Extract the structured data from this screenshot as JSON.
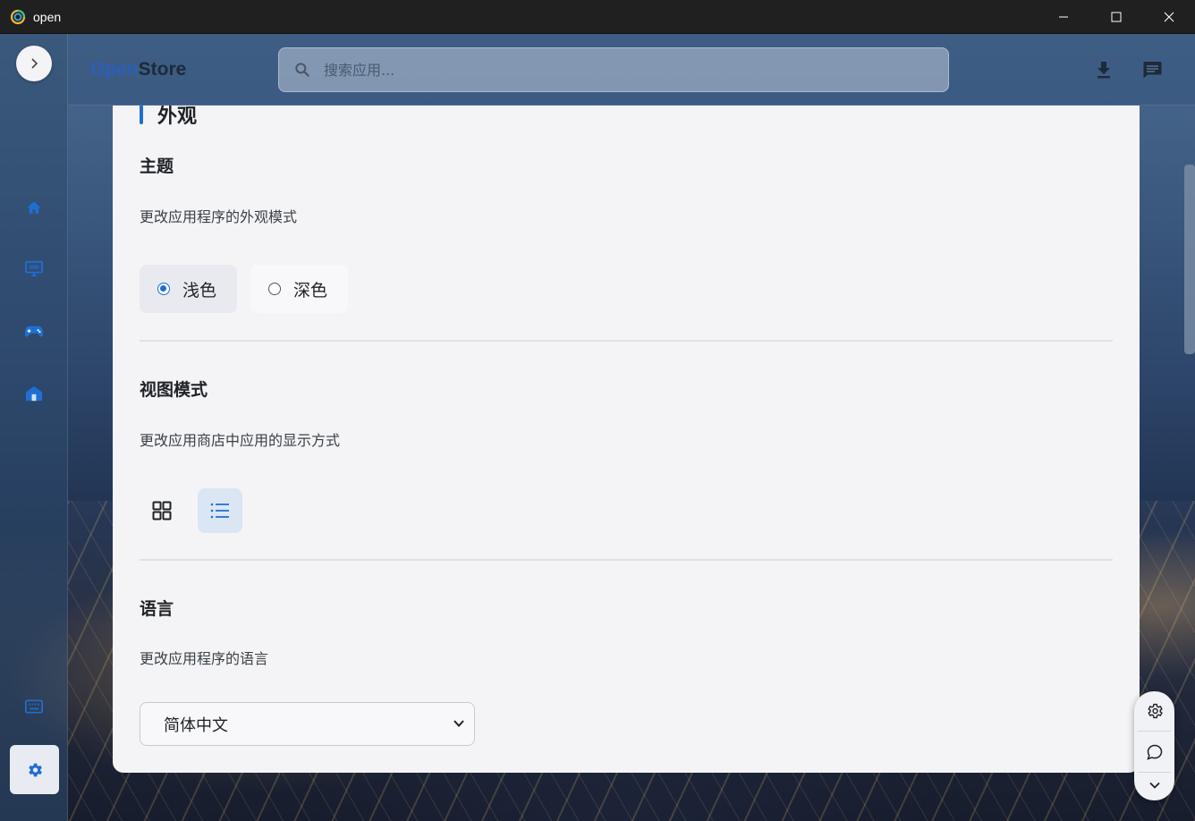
{
  "window": {
    "title": "open"
  },
  "header": {
    "brand_part1": "Open",
    "brand_part2": "Store",
    "search_placeholder": "搜索应用..."
  },
  "sidebar": {
    "items": [
      {
        "icon": "home-icon"
      },
      {
        "icon": "desktop-icon"
      },
      {
        "icon": "gamepad-icon"
      },
      {
        "icon": "store-icon"
      },
      {
        "icon": "keyboard-icon"
      },
      {
        "icon": "settings-icon",
        "active": true
      }
    ]
  },
  "appearance": {
    "section_title": "外观",
    "theme": {
      "heading": "主题",
      "description": "更改应用程序的外观模式",
      "options": [
        {
          "label": "浅色",
          "selected": true
        },
        {
          "label": "深色",
          "selected": false
        }
      ]
    },
    "view_mode": {
      "heading": "视图模式",
      "description": "更改应用商店中应用的显示方式",
      "selected": "list"
    },
    "language": {
      "heading": "语言",
      "description": "更改应用程序的语言",
      "selected": "简体中文"
    }
  },
  "colors": {
    "accent": "#1f6ed4",
    "card_bg": "#f4f4f7",
    "titlebar_bg": "#202020"
  }
}
